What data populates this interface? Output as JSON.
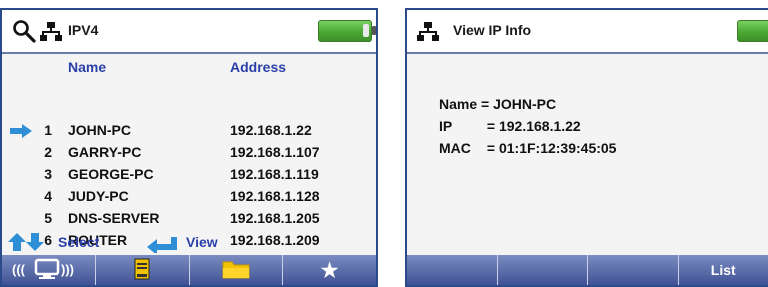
{
  "left": {
    "title": "IPV4",
    "columns": {
      "name": "Name",
      "address": "Address"
    },
    "selected_index": 0,
    "rows": [
      {
        "num": "1",
        "name": "JOHN-PC",
        "address": "192.168.1.22"
      },
      {
        "num": "2",
        "name": "GARRY-PC",
        "address": "192.168.1.107"
      },
      {
        "num": "3",
        "name": "GEORGE-PC",
        "address": "192.168.1.119"
      },
      {
        "num": "4",
        "name": "JUDY-PC",
        "address": "192.168.1.128"
      },
      {
        "num": "5",
        "name": "DNS-SERVER",
        "address": "192.168.1.205"
      },
      {
        "num": "6",
        "name": "ROUTER",
        "address": "192.168.1.209"
      }
    ],
    "hints": {
      "select": "Select",
      "view": "View"
    },
    "softkeys": [
      "",
      "",
      "",
      "★"
    ]
  },
  "right": {
    "title": "View IP Info",
    "info": {
      "name_label": "Name =",
      "name_value": "JOHN-PC",
      "ip_label": "IP",
      "ip_value": "= 192.168.1.22",
      "mac_label": "MAC",
      "mac_value": "= 01:1F:12:39:45:05"
    },
    "softkeys": [
      "",
      "",
      "",
      "List"
    ]
  },
  "colors": {
    "accent": "#2b3fa8",
    "battery": "#4aa832",
    "softkey_bar": "#3f5194",
    "folder": "#f2c200",
    "selection_arrow": "#2f8fd6"
  },
  "battery_level": 1.0
}
